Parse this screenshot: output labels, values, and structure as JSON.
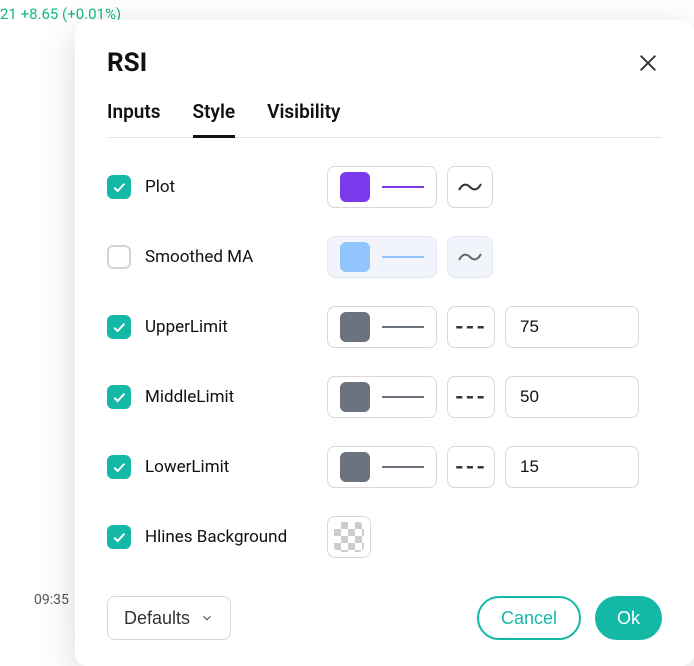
{
  "bg": {
    "quote_fragment": "21 +8.65 (+0.01%)",
    "time_label": "09:35"
  },
  "modal": {
    "title": "RSI",
    "tabs": {
      "inputs": "Inputs",
      "style": "Style",
      "visibility": "Visibility",
      "active": "style"
    },
    "rows": {
      "plot": {
        "label": "Plot",
        "checked": true,
        "color": "#7c3aed",
        "line_color": "#7c3aed"
      },
      "smoothed": {
        "label": "Smoothed MA",
        "checked": false,
        "color": "#93c5fd",
        "line_color": "#93c5fd"
      },
      "upper": {
        "label": "UpperLimit",
        "checked": true,
        "color": "#6b7280",
        "line_color": "#6b7280",
        "value": "75"
      },
      "middle": {
        "label": "MiddleLimit",
        "checked": true,
        "color": "#6b7280",
        "line_color": "#6b7280",
        "value": "50"
      },
      "lower": {
        "label": "LowerLimit",
        "checked": true,
        "color": "#6b7280",
        "line_color": "#6b7280",
        "value": "15"
      },
      "hlines": {
        "label": "Hlines Background",
        "checked": true
      }
    },
    "footer": {
      "defaults": "Defaults",
      "cancel": "Cancel",
      "ok": "Ok"
    }
  }
}
